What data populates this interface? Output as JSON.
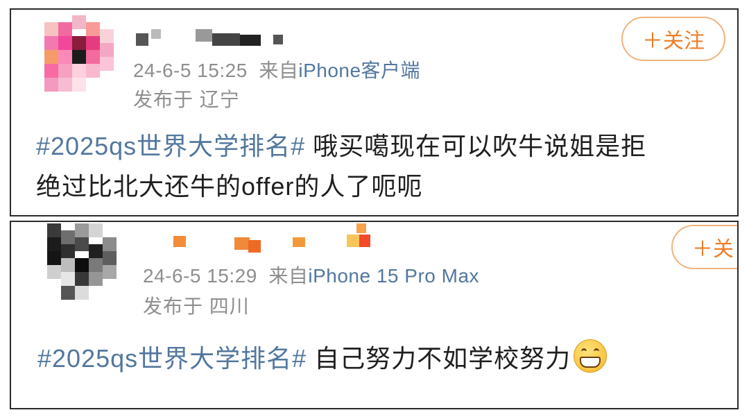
{
  "posts": [
    {
      "time": "24-6-5 15:25",
      "source_prefix": "来自",
      "source": "iPhone客户端",
      "location": "发布于 辽宁",
      "follow_label": "＋关注",
      "hashtag": "#2025qs世界大学排名#",
      "text_line1": " 哦买噶现在可以吹牛说姐是拒",
      "text_line2": "绝过比北大还牛的offer的人了呃呃"
    },
    {
      "time": "24-6-5 15:29",
      "source_prefix": "来自",
      "source": "iPhone 15 Pro Max",
      "location": "发布于 四川",
      "follow_label": "＋关",
      "hashtag": "#2025qs世界大学排名#",
      "text": " 自己努力不如学校努力",
      "emoji": "grinning-face-icon"
    }
  ],
  "colors": {
    "link": "#52779e",
    "meta": "#8e8e8e",
    "follow_text": "#ec7e2a",
    "follow_border": "#f0b27c"
  }
}
